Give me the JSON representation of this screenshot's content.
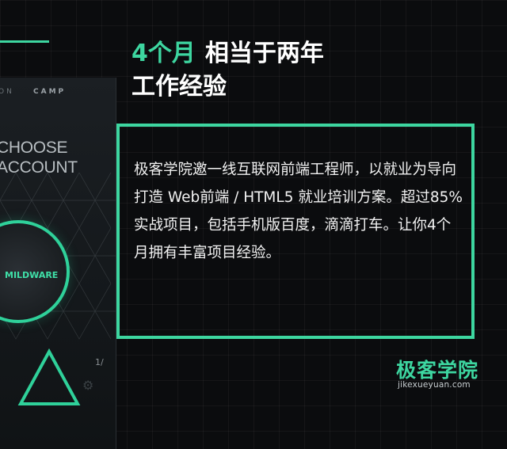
{
  "heading": {
    "accent": "4个月",
    "rest": "相当于两年",
    "line2": "工作经验"
  },
  "body": "极客学院邀一线互联网前端工程师，以就业为导向打造 Web前端 / HTML5 就业培训方案。超过85%实战项目，包括手机版百度，滴滴打车。让你4个月拥有丰富项目经验。",
  "phone": {
    "top_left": "ON",
    "top_right": "CAMP",
    "choose_line1": "CHOOSE",
    "choose_line2": "ACCOUNT",
    "button_label": "MILDWARE",
    "page_indicator": "1/"
  },
  "logo": {
    "name": "极客学院",
    "url": "jikexueyuan.com"
  },
  "colors": {
    "accent": "#3dd6a0",
    "background": "#0b0c0e"
  }
}
